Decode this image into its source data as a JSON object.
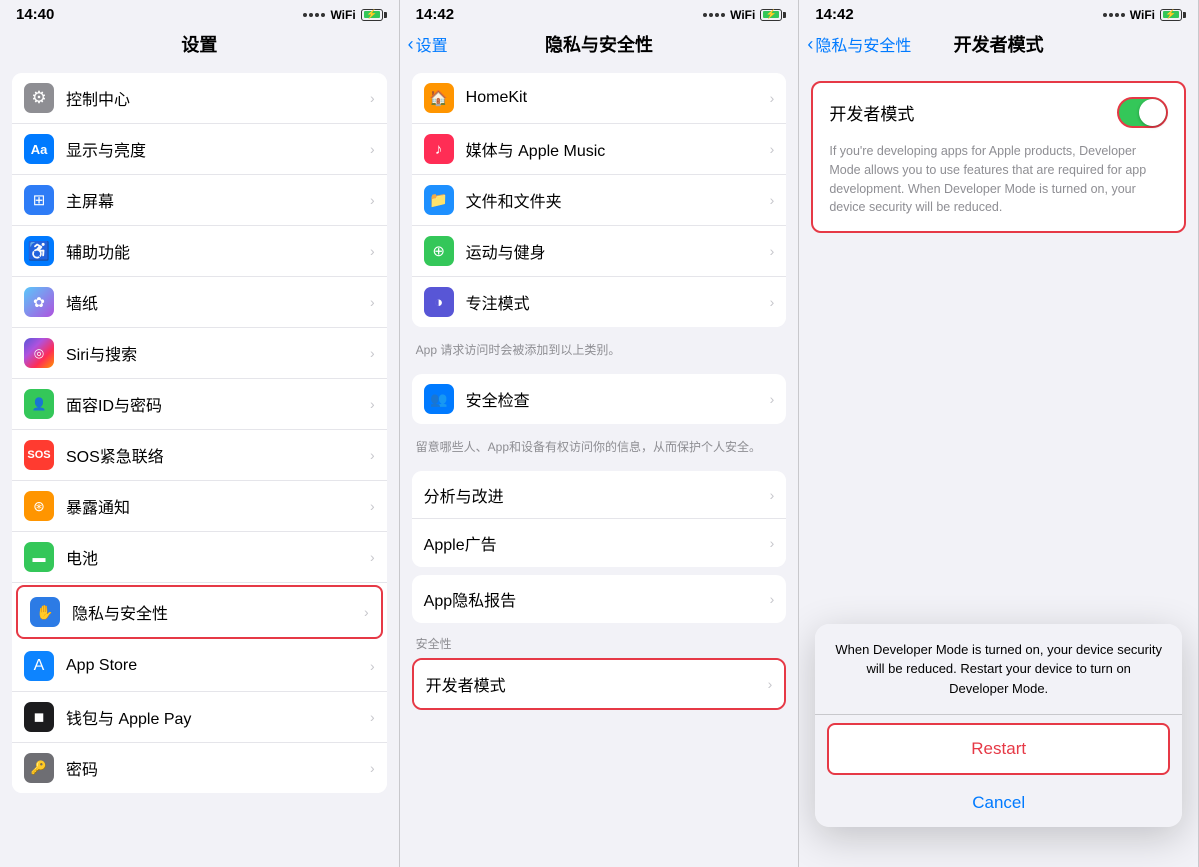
{
  "panel1": {
    "time": "14:40",
    "title": "设置",
    "items": [
      {
        "id": "control-center",
        "label": "控制中心",
        "icon": "⚙",
        "bg": "bg-gray"
      },
      {
        "id": "display",
        "label": "显示与亮度",
        "icon": "Aa",
        "bg": "bg-blue"
      },
      {
        "id": "home-screen",
        "label": "主屏幕",
        "icon": "⊞",
        "bg": "bg-blue"
      },
      {
        "id": "accessibility",
        "label": "辅助功能",
        "icon": "♿",
        "bg": "bg-blue"
      },
      {
        "id": "wallpaper",
        "label": "墙纸",
        "icon": "✿",
        "bg": "bg-teal"
      },
      {
        "id": "siri",
        "label": "Siri与搜索",
        "icon": "◎",
        "bg": "bg-dark"
      },
      {
        "id": "face-id",
        "label": "面容ID与密码",
        "icon": "👤",
        "bg": "bg-green"
      },
      {
        "id": "sos",
        "label": "SOS紧急联络",
        "icon": "SOS",
        "bg": "bg-sos"
      },
      {
        "id": "exposure",
        "label": "暴露通知",
        "icon": "⊛",
        "bg": "bg-exposure"
      },
      {
        "id": "battery",
        "label": "电池",
        "icon": "▬",
        "bg": "bg-battery"
      },
      {
        "id": "privacy",
        "label": "隐私与安全性",
        "icon": "✋",
        "bg": "bg-privacy",
        "highlighted": true
      },
      {
        "id": "appstore",
        "label": "App Store",
        "icon": "A",
        "bg": "bg-appstore"
      },
      {
        "id": "wallet",
        "label": "钱包与 Apple Pay",
        "icon": "◼",
        "bg": "bg-wallet"
      },
      {
        "id": "password",
        "label": "密码",
        "icon": "🔑",
        "bg": "bg-password"
      }
    ]
  },
  "panel2": {
    "time": "14:42",
    "back_label": "设置",
    "title": "隐私与安全性",
    "groups": [
      {
        "items": [
          {
            "id": "homekit",
            "label": "HomeKit",
            "icon": "🏠",
            "bg": "bg-orange"
          },
          {
            "id": "media-music",
            "label": "媒体与 Apple Music",
            "icon": "♪",
            "bg": "bg-pink"
          },
          {
            "id": "files",
            "label": "文件和文件夹",
            "icon": "📁",
            "bg": "bg-blue"
          },
          {
            "id": "fitness",
            "label": "运动与健身",
            "icon": "⊕",
            "bg": "bg-green"
          },
          {
            "id": "focus",
            "label": "专注模式",
            "icon": "◑",
            "bg": "bg-indigo"
          }
        ]
      }
    ],
    "note1": "App 请求访问时会被添加到以上类别。",
    "group2": [
      {
        "id": "safety-check",
        "label": "安全检查",
        "icon": "👥",
        "bg": "bg-blue"
      }
    ],
    "note2": "留意哪些人、App和设备有权访问你的信息，从而保护个人安全。",
    "group3": [
      {
        "id": "analytics",
        "label": "分析与改进",
        "icon": "",
        "bg": ""
      },
      {
        "id": "apple-ads",
        "label": "Apple广告",
        "icon": "",
        "bg": ""
      }
    ],
    "group4": [
      {
        "id": "privacy-report",
        "label": "App隐私报告",
        "icon": "",
        "bg": ""
      }
    ],
    "section_label": "安全性",
    "group5_highlighted": true,
    "group5": [
      {
        "id": "developer-mode",
        "label": "开发者模式",
        "icon": "",
        "bg": ""
      }
    ]
  },
  "panel3": {
    "time": "14:42",
    "back_label": "隐私与安全性",
    "title": "开发者模式",
    "toggle_label": "开发者模式",
    "toggle_on": true,
    "desc": "If you're developing apps for Apple products, Developer Mode allows you to use features that are required for app development. When Developer Mode is turned on, your device security will be reduced.",
    "alert": {
      "message": "When Developer Mode is turned on, your device security will be reduced. Restart your device to turn on Developer Mode.",
      "restart_label": "Restart",
      "cancel_label": "Cancel"
    }
  }
}
